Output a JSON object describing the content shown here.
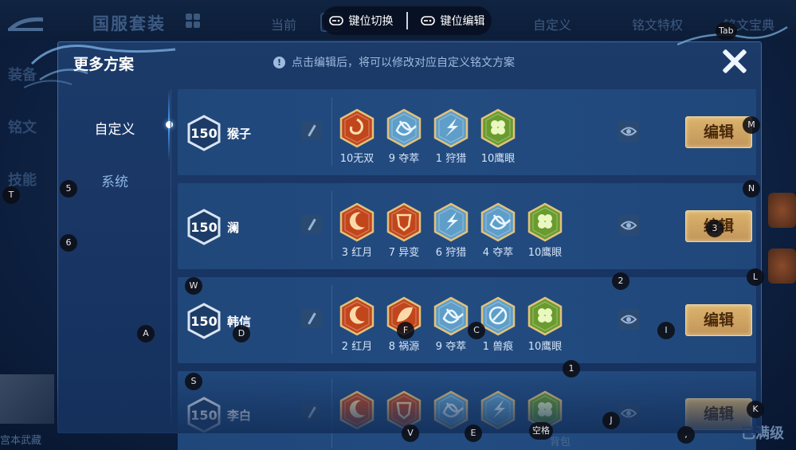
{
  "background": {
    "title": "国服套装",
    "current_label": "当前",
    "tabs": [
      "自定义",
      "铭文特权",
      "铭文宝典"
    ],
    "side": [
      "装备",
      "铭文",
      "技能"
    ],
    "bottom_left": "宫本武藏",
    "bottom_mid": "背包",
    "bottom_right": "已满级"
  },
  "top_bar": {
    "switch_label": "键位切换",
    "edit_label": "键位编辑"
  },
  "panel": {
    "title": "更多方案",
    "notice": "点击编辑后，将可以修改对应自定义铭文方案",
    "sidebar": {
      "active": "自定义",
      "other": "系统"
    }
  },
  "schemes": [
    {
      "level": "150",
      "hero": "猴子",
      "edit_label": "编辑",
      "runes": [
        {
          "label": "10无双",
          "color": "#c2461c",
          "icon": "swirl"
        },
        {
          "label": "9 夺萃",
          "color": "#5f9ec9",
          "icon": "knot"
        },
        {
          "label": "1 狩猎",
          "color": "#5f9ec9",
          "icon": "bolt"
        },
        {
          "label": "10鹰眼",
          "color": "#6a9b2e",
          "icon": "clover"
        }
      ]
    },
    {
      "level": "150",
      "hero": "澜",
      "edit_label": "编辑",
      "runes": [
        {
          "label": "3 红月",
          "color": "#c2461c",
          "icon": "moon"
        },
        {
          "label": "7 异变",
          "color": "#c2461c",
          "icon": "shield"
        },
        {
          "label": "6 狩猎",
          "color": "#5f9ec9",
          "icon": "bolt"
        },
        {
          "label": "4 夺萃",
          "color": "#5f9ec9",
          "icon": "knot"
        },
        {
          "label": "10鹰眼",
          "color": "#6a9b2e",
          "icon": "clover"
        }
      ]
    },
    {
      "level": "150",
      "hero": "韩信",
      "edit_label": "编辑",
      "runes": [
        {
          "label": "2 红月",
          "color": "#c2461c",
          "icon": "moon"
        },
        {
          "label": "8 祸源",
          "color": "#c2461c",
          "icon": "leaf"
        },
        {
          "label": "9 夺萃",
          "color": "#5f9ec9",
          "icon": "knot"
        },
        {
          "label": "1 兽痕",
          "color": "#5f9ec9",
          "icon": "claw"
        },
        {
          "label": "10鹰眼",
          "color": "#6a9b2e",
          "icon": "clover"
        }
      ]
    },
    {
      "level": "150",
      "hero": "李白",
      "edit_label": "编辑",
      "runes": [
        {
          "label": "",
          "color": "#c2461c",
          "icon": "moon"
        },
        {
          "label": "",
          "color": "#c2461c",
          "icon": "shield"
        },
        {
          "label": "",
          "color": "#5f9ec9",
          "icon": "knot"
        },
        {
          "label": "",
          "color": "#5f9ec9",
          "icon": "bolt"
        },
        {
          "label": "",
          "color": "#6a9b2e",
          "icon": "clover"
        }
      ]
    }
  ],
  "key_hints": [
    "Tab",
    "M",
    "N",
    "T",
    "5",
    "6",
    "3",
    "L",
    "2",
    "W",
    "A",
    "D",
    "F",
    "C",
    "I",
    "1",
    "S",
    "J",
    "K",
    "V",
    "E",
    "空格",
    ","
  ]
}
